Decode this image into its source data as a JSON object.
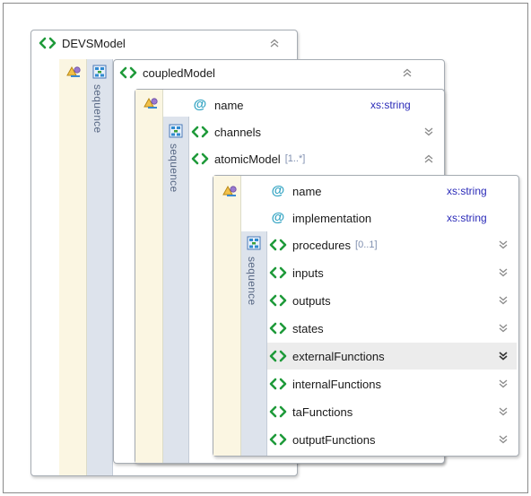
{
  "devs_model": {
    "label": "DEVSModel"
  },
  "coupled_model": {
    "label": "coupledModel",
    "sequence_label": "sequence"
  },
  "coupled_children": [
    {
      "label": "name",
      "kind": "attribute",
      "type": "xs:string"
    },
    {
      "label": "channels",
      "kind": "element"
    },
    {
      "label": "atomicModel",
      "kind": "element",
      "multiplicity": "[1..*]"
    }
  ],
  "coupled_sequence_label": "sequence",
  "atomic_attributes": [
    {
      "label": "name",
      "kind": "attribute",
      "type": "xs:string"
    },
    {
      "label": "implementation",
      "kind": "attribute",
      "type": "xs:string"
    }
  ],
  "atomic_sequence_label": "sequence",
  "atomic_children": [
    {
      "label": "procedures",
      "multiplicity": "[0..1]"
    },
    {
      "label": "inputs"
    },
    {
      "label": "outputs"
    },
    {
      "label": "states"
    },
    {
      "label": "externalFunctions",
      "highlighted": true
    },
    {
      "label": "internalFunctions"
    },
    {
      "label": "taFunctions"
    },
    {
      "label": "outputFunctions"
    }
  ],
  "colors": {
    "element_icon": "#1f9a3a",
    "attribute_icon": "#2aa0c0",
    "type_text": "#2a2ab8",
    "sequence_strip": "#dde3ec",
    "selector_strip": "#fbf6e2"
  }
}
